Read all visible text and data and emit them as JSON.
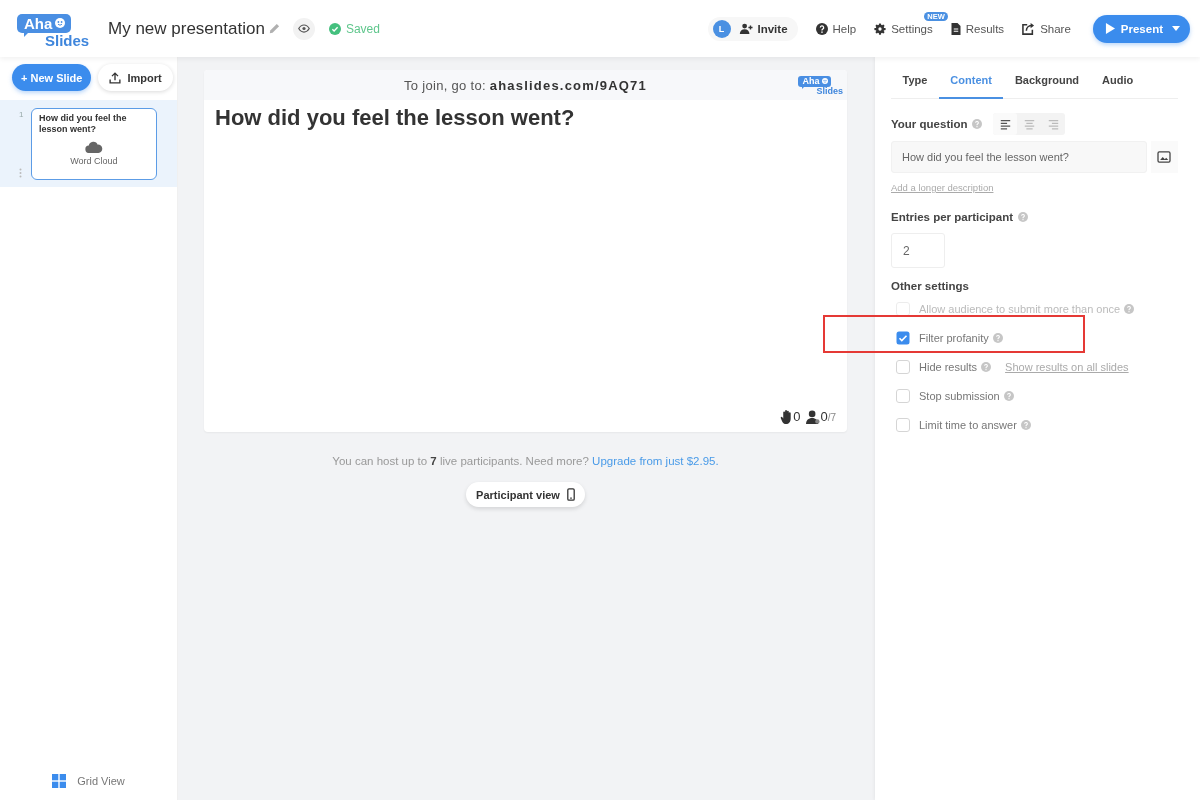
{
  "header": {
    "logo": {
      "top": "Aha",
      "bottom": "Slides"
    },
    "title": "My new presentation",
    "save_status": "Saved",
    "avatar": "L",
    "invite": "Invite",
    "actions": [
      {
        "kind": "help",
        "label": "Help"
      },
      {
        "kind": "settings",
        "label": "Settings",
        "badge": "NEW"
      },
      {
        "kind": "results",
        "label": "Results"
      },
      {
        "kind": "share",
        "label": "Share"
      }
    ],
    "present": "Present"
  },
  "sidebar": {
    "new_slide": "+ New Slide",
    "import": "Import",
    "slides": [
      {
        "number": "1",
        "title": "How did you feel the lesson went?",
        "kind": "word_cloud",
        "type": "Word Cloud",
        "selected": true
      }
    ],
    "grid_view": "Grid View"
  },
  "slide": {
    "join": "To join, go to: **ahaslides.com/9AQ71**",
    "logo": {
      "top": "Aha",
      "bottom": "Slides"
    },
    "question": "How did you feel the lesson went?",
    "raised_hands": "0",
    "participants": "0",
    "participant_limit": "/7"
  },
  "notice": {
    "text": "You can host up to **7** live participants. Need more?",
    "link": "Upgrade from just $2.95."
  },
  "participant_view": "Participant view",
  "panel": {
    "tabs": [
      {
        "label": "Type",
        "selected": false
      },
      {
        "label": "Content",
        "selected": true
      },
      {
        "label": "Background",
        "selected": false
      },
      {
        "label": "Audio",
        "selected": false
      }
    ],
    "question_label": "Your question",
    "alignments": [
      {
        "kind": "left",
        "selected": true
      },
      {
        "kind": "center",
        "selected": false
      },
      {
        "kind": "right",
        "selected": false
      }
    ],
    "question": "How did you feel the lesson went?",
    "description_link": "Add a longer description",
    "entries_label": "Entries per participant",
    "entries": "2",
    "other_label": "Other settings",
    "options": [
      {
        "label": "Allow audience to submit more than once",
        "checked": false,
        "disabled": true,
        "highlighted": false
      },
      {
        "label": "Filter profanity",
        "checked": true,
        "disabled": false,
        "highlighted": true
      },
      {
        "label": "Hide results",
        "checked": false,
        "disabled": false,
        "highlighted": false,
        "link": "Show results on all slides"
      },
      {
        "label": "Stop submission",
        "checked": false,
        "disabled": false,
        "highlighted": false
      },
      {
        "label": "Limit time to answer",
        "checked": false,
        "disabled": false,
        "highlighted": false
      }
    ]
  }
}
